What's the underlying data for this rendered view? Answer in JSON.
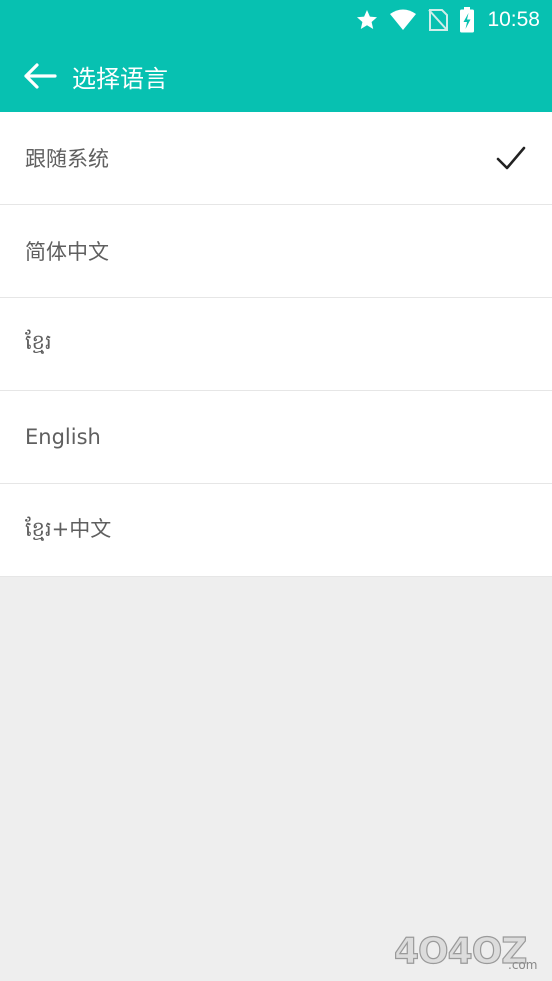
{
  "status_bar": {
    "time": "10:58",
    "icons": [
      "star-icon",
      "wifi-icon",
      "no-sim-icon",
      "battery-charging-icon"
    ]
  },
  "toolbar": {
    "back_icon": "arrow-left-icon",
    "title": "选择语言"
  },
  "languages": [
    {
      "label": "跟随系统",
      "selected": true
    },
    {
      "label": "简体中文",
      "selected": false
    },
    {
      "label": "ខ្មែរ",
      "selected": false
    },
    {
      "label": "English",
      "selected": false
    },
    {
      "label": "ខ្មែរ+中文",
      "selected": false
    }
  ],
  "colors": {
    "accent": "#07c1b1",
    "background": "#eeeeee",
    "text": "#5f5f5f"
  },
  "watermark": {
    "text": "4O4OZ",
    "domain": ".com"
  }
}
